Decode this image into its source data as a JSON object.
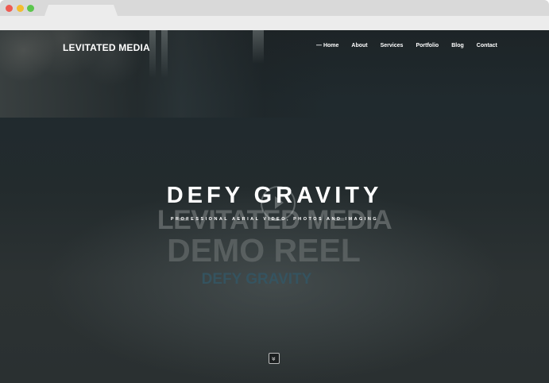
{
  "brand": {
    "name": "LEVITATED MEDIA"
  },
  "nav": {
    "items": [
      {
        "label": "— Home"
      },
      {
        "label": "About"
      },
      {
        "label": "Services"
      },
      {
        "label": "Portfolio"
      },
      {
        "label": "Blog"
      },
      {
        "label": "Contact"
      }
    ]
  },
  "hero": {
    "headline": "DEFY GRAVITY",
    "subhead": "PROFESSIONAL AERIAL VIDEO, PHOTOS AND IMAGING",
    "video_overlay": {
      "line1": "LEVITATED MEDIA",
      "line2": "DEMO REEL",
      "line3": "DEFY GRAVITY"
    },
    "scroll_icon": "double-chevron-down-icon"
  },
  "colors": {
    "window_red": "#ee5b52",
    "window_yellow": "#f3bd30",
    "window_green": "#5bc64d",
    "text": "#ffffff"
  }
}
